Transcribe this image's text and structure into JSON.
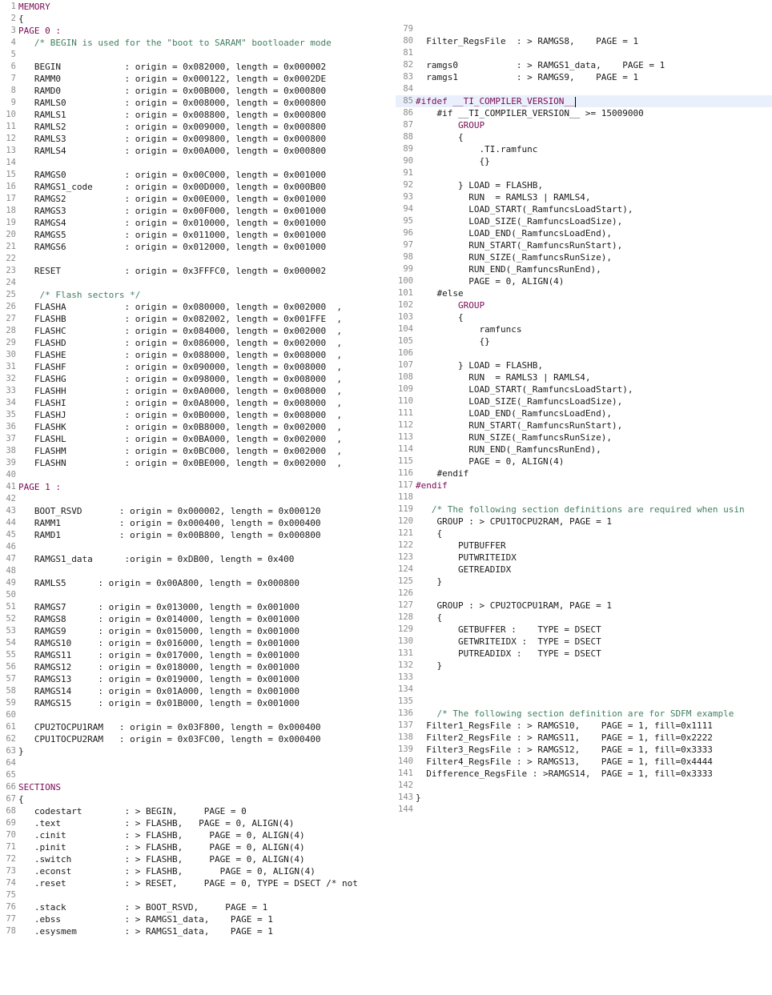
{
  "left_lines": [
    {
      "n": "1",
      "t": "MEMORY",
      "c": "kw"
    },
    {
      "n": "2",
      "t": "{"
    },
    {
      "n": "3",
      "t": "PAGE 0 :",
      "c": "kw"
    },
    {
      "n": "4",
      "t": "   /* BEGIN is used for the \"boot to SARAM\" bootloader mode",
      "c": "cm"
    },
    {
      "n": "5",
      "t": ""
    },
    {
      "n": "6",
      "t": "   BEGIN            : origin = 0x082000, length = 0x000002"
    },
    {
      "n": "7",
      "t": "   RAMM0            : origin = 0x000122, length = 0x0002DE"
    },
    {
      "n": "8",
      "t": "   RAMD0            : origin = 0x00B000, length = 0x000800"
    },
    {
      "n": "9",
      "t": "   RAMLS0           : origin = 0x008000, length = 0x000800"
    },
    {
      "n": "10",
      "t": "   RAMLS1           : origin = 0x008800, length = 0x000800"
    },
    {
      "n": "11",
      "t": "   RAMLS2           : origin = 0x009000, length = 0x000800"
    },
    {
      "n": "12",
      "t": "   RAMLS3           : origin = 0x009800, length = 0x000800"
    },
    {
      "n": "13",
      "t": "   RAMLS4           : origin = 0x00A000, length = 0x000800"
    },
    {
      "n": "14",
      "t": ""
    },
    {
      "n": "15",
      "t": "   RAMGS0           : origin = 0x00C000, length = 0x001000"
    },
    {
      "n": "16",
      "t": "   RAMGS1_code      : origin = 0x00D000, length = 0x000B00"
    },
    {
      "n": "17",
      "t": "   RAMGS2           : origin = 0x00E000, length = 0x001000"
    },
    {
      "n": "18",
      "t": "   RAMGS3           : origin = 0x00F000, length = 0x001000"
    },
    {
      "n": "19",
      "t": "   RAMGS4           : origin = 0x010000, length = 0x001000"
    },
    {
      "n": "20",
      "t": "   RAMGS5           : origin = 0x011000, length = 0x001000"
    },
    {
      "n": "21",
      "t": "   RAMGS6           : origin = 0x012000, length = 0x001000"
    },
    {
      "n": "22",
      "t": ""
    },
    {
      "n": "23",
      "t": "   RESET            : origin = 0x3FFFC0, length = 0x000002"
    },
    {
      "n": "24",
      "t": ""
    },
    {
      "n": "25",
      "t": "    /* Flash sectors */",
      "c": "cm"
    },
    {
      "n": "26",
      "t": "   FLASHA           : origin = 0x080000, length = 0x002000  ,"
    },
    {
      "n": "27",
      "t": "   FLASHB           : origin = 0x082002, length = 0x001FFE  ,"
    },
    {
      "n": "28",
      "t": "   FLASHC           : origin = 0x084000, length = 0x002000  ,"
    },
    {
      "n": "29",
      "t": "   FLASHD           : origin = 0x086000, length = 0x002000  ,"
    },
    {
      "n": "30",
      "t": "   FLASHE           : origin = 0x088000, length = 0x008000  ,"
    },
    {
      "n": "31",
      "t": "   FLASHF           : origin = 0x090000, length = 0x008000  ,"
    },
    {
      "n": "32",
      "t": "   FLASHG           : origin = 0x098000, length = 0x008000  ,"
    },
    {
      "n": "33",
      "t": "   FLASHH           : origin = 0x0A0000, length = 0x008000  ,"
    },
    {
      "n": "34",
      "t": "   FLASHI           : origin = 0x0A8000, length = 0x008000  ,"
    },
    {
      "n": "35",
      "t": "   FLASHJ           : origin = 0x0B0000, length = 0x008000  ,"
    },
    {
      "n": "36",
      "t": "   FLASHK           : origin = 0x0B8000, length = 0x002000  ,"
    },
    {
      "n": "37",
      "t": "   FLASHL           : origin = 0x0BA000, length = 0x002000  ,"
    },
    {
      "n": "38",
      "t": "   FLASHM           : origin = 0x0BC000, length = 0x002000  ,"
    },
    {
      "n": "39",
      "t": "   FLASHN           : origin = 0x0BE000, length = 0x002000  ,"
    },
    {
      "n": "40",
      "t": ""
    },
    {
      "n": "41",
      "t": "PAGE 1 :",
      "c": "kw"
    },
    {
      "n": "42",
      "t": ""
    },
    {
      "n": "43",
      "t": "   BOOT_RSVD       : origin = 0x000002, length = 0x000120"
    },
    {
      "n": "44",
      "t": "   RAMM1           : origin = 0x000400, length = 0x000400"
    },
    {
      "n": "45",
      "t": "   RAMD1           : origin = 0x00B800, length = 0x000800"
    },
    {
      "n": "46",
      "t": ""
    },
    {
      "n": "47",
      "t": "   RAMGS1_data      :origin = 0xDB00, length = 0x400"
    },
    {
      "n": "48",
      "t": ""
    },
    {
      "n": "49",
      "t": "   RAMLS5      : origin = 0x00A800, length = 0x000800"
    },
    {
      "n": "50",
      "t": ""
    },
    {
      "n": "51",
      "t": "   RAMGS7      : origin = 0x013000, length = 0x001000"
    },
    {
      "n": "52",
      "t": "   RAMGS8      : origin = 0x014000, length = 0x001000"
    },
    {
      "n": "53",
      "t": "   RAMGS9      : origin = 0x015000, length = 0x001000"
    },
    {
      "n": "54",
      "t": "   RAMGS10     : origin = 0x016000, length = 0x001000"
    },
    {
      "n": "55",
      "t": "   RAMGS11     : origin = 0x017000, length = 0x001000"
    },
    {
      "n": "56",
      "t": "   RAMGS12     : origin = 0x018000, length = 0x001000"
    },
    {
      "n": "57",
      "t": "   RAMGS13     : origin = 0x019000, length = 0x001000"
    },
    {
      "n": "58",
      "t": "   RAMGS14     : origin = 0x01A000, length = 0x001000"
    },
    {
      "n": "59",
      "t": "   RAMGS15     : origin = 0x01B000, length = 0x001000"
    },
    {
      "n": "60",
      "t": ""
    },
    {
      "n": "61",
      "t": "   CPU2TOCPU1RAM   : origin = 0x03F800, length = 0x000400"
    },
    {
      "n": "62",
      "t": "   CPU1TOCPU2RAM   : origin = 0x03FC00, length = 0x000400"
    },
    {
      "n": "63",
      "t": "}"
    },
    {
      "n": "64",
      "t": ""
    },
    {
      "n": "65",
      "t": ""
    },
    {
      "n": "66",
      "t": "SECTIONS",
      "c": "kw"
    },
    {
      "n": "67",
      "t": "{"
    },
    {
      "n": "68",
      "t": "   codestart        : > BEGIN,     PAGE = 0"
    },
    {
      "n": "69",
      "t": "   .text            : > FLASHB,   PAGE = 0, ALIGN(4)"
    },
    {
      "n": "70",
      "t": "   .cinit           : > FLASHB,     PAGE = 0, ALIGN(4)"
    },
    {
      "n": "71",
      "t": "   .pinit           : > FLASHB,     PAGE = 0, ALIGN(4)"
    },
    {
      "n": "72",
      "t": "   .switch          : > FLASHB,     PAGE = 0, ALIGN(4)"
    },
    {
      "n": "73",
      "t": "   .econst          : > FLASHB,       PAGE = 0, ALIGN(4)"
    },
    {
      "n": "74",
      "t": "   .reset           : > RESET,     PAGE = 0, TYPE = DSECT /* not us"
    },
    {
      "n": "75",
      "t": ""
    },
    {
      "n": "76",
      "t": "   .stack           : > BOOT_RSVD,     PAGE = 1"
    },
    {
      "n": "77",
      "t": "   .ebss            : > RAMGS1_data,    PAGE = 1"
    },
    {
      "n": "78",
      "t": "   .esysmem         : > RAMGS1_data,    PAGE = 1"
    }
  ],
  "right_lines": [
    {
      "n": "",
      "t": ""
    },
    {
      "n": "79",
      "t": ""
    },
    {
      "n": "80",
      "t": "  Filter_RegsFile  : > RAMGS8,    PAGE = 1"
    },
    {
      "n": "81",
      "t": ""
    },
    {
      "n": "82",
      "t": "  ramgs0           : > RAMGS1_data,    PAGE = 1"
    },
    {
      "n": "83",
      "t": "  ramgs1           : > RAMGS9,    PAGE = 1"
    },
    {
      "n": "84",
      "t": ""
    },
    {
      "n": "85",
      "t": "#ifdef __TI_COMPILER_VERSION__",
      "c": "pp",
      "hl": true,
      "caret": true
    },
    {
      "n": "86",
      "t": "    #if __TI_COMPILER_VERSION__ >= 15009000"
    },
    {
      "n": "87",
      "t": "        GROUP",
      "c": "kw"
    },
    {
      "n": "88",
      "t": "        {"
    },
    {
      "n": "89",
      "t": "            .TI.ramfunc"
    },
    {
      "n": "90",
      "t": "            {}"
    },
    {
      "n": "91",
      "t": ""
    },
    {
      "n": "92",
      "t": "        } LOAD = FLASHB,"
    },
    {
      "n": "93",
      "t": "          RUN  = RAMLS3 | RAMLS4,"
    },
    {
      "n": "94",
      "t": "          LOAD_START(_RamfuncsLoadStart),"
    },
    {
      "n": "95",
      "t": "          LOAD_SIZE(_RamfuncsLoadSize),"
    },
    {
      "n": "96",
      "t": "          LOAD_END(_RamfuncsLoadEnd),"
    },
    {
      "n": "97",
      "t": "          RUN_START(_RamfuncsRunStart),"
    },
    {
      "n": "98",
      "t": "          RUN_SIZE(_RamfuncsRunSize),"
    },
    {
      "n": "99",
      "t": "          RUN_END(_RamfuncsRunEnd),"
    },
    {
      "n": "100",
      "t": "          PAGE = 0, ALIGN(4)"
    },
    {
      "n": "101",
      "t": "    #else"
    },
    {
      "n": "102",
      "t": "        GROUP",
      "c": "kw"
    },
    {
      "n": "103",
      "t": "        {"
    },
    {
      "n": "104",
      "t": "            ramfuncs"
    },
    {
      "n": "105",
      "t": "            {}"
    },
    {
      "n": "106",
      "t": ""
    },
    {
      "n": "107",
      "t": "        } LOAD = FLASHB,"
    },
    {
      "n": "108",
      "t": "          RUN  = RAMLS3 | RAMLS4,"
    },
    {
      "n": "109",
      "t": "          LOAD_START(_RamfuncsLoadStart),"
    },
    {
      "n": "110",
      "t": "          LOAD_SIZE(_RamfuncsLoadSize),"
    },
    {
      "n": "111",
      "t": "          LOAD_END(_RamfuncsLoadEnd),"
    },
    {
      "n": "112",
      "t": "          RUN_START(_RamfuncsRunStart),"
    },
    {
      "n": "113",
      "t": "          RUN_SIZE(_RamfuncsRunSize),"
    },
    {
      "n": "114",
      "t": "          RUN_END(_RamfuncsRunEnd),"
    },
    {
      "n": "115",
      "t": "          PAGE = 0, ALIGN(4)"
    },
    {
      "n": "116",
      "t": "    #endif"
    },
    {
      "n": "117",
      "t": "#endif",
      "c": "pp"
    },
    {
      "n": "118",
      "t": ""
    },
    {
      "n": "119",
      "t": "   /* The following section definitions are required when usin",
      "c": "cm"
    },
    {
      "n": "120",
      "t": "    GROUP : > CPU1TOCPU2RAM, PAGE = 1"
    },
    {
      "n": "121",
      "t": "    {"
    },
    {
      "n": "122",
      "t": "        PUTBUFFER"
    },
    {
      "n": "123",
      "t": "        PUTWRITEIDX"
    },
    {
      "n": "124",
      "t": "        GETREADIDX"
    },
    {
      "n": "125",
      "t": "    }"
    },
    {
      "n": "126",
      "t": ""
    },
    {
      "n": "127",
      "t": "    GROUP : > CPU2TOCPU1RAM, PAGE = 1"
    },
    {
      "n": "128",
      "t": "    {"
    },
    {
      "n": "129",
      "t": "        GETBUFFER :    TYPE = DSECT"
    },
    {
      "n": "130",
      "t": "        GETWRITEIDX :  TYPE = DSECT"
    },
    {
      "n": "131",
      "t": "        PUTREADIDX :   TYPE = DSECT"
    },
    {
      "n": "132",
      "t": "    }"
    },
    {
      "n": "133",
      "t": ""
    },
    {
      "n": "134",
      "t": ""
    },
    {
      "n": "135",
      "t": ""
    },
    {
      "n": "136",
      "t": "    /* The following section definition are for SDFM example",
      "c": "cm"
    },
    {
      "n": "137",
      "t": "  Filter1_RegsFile : > RAMGS10,    PAGE = 1, fill=0x1111"
    },
    {
      "n": "138",
      "t": "  Filter2_RegsFile : > RAMGS11,    PAGE = 1, fill=0x2222"
    },
    {
      "n": "139",
      "t": "  Filter3_RegsFile : > RAMGS12,    PAGE = 1, fill=0x3333"
    },
    {
      "n": "140",
      "t": "  Filter4_RegsFile : > RAMGS13,    PAGE = 1, fill=0x4444"
    },
    {
      "n": "141",
      "t": "  Difference_RegsFile : >RAMGS14,  PAGE = 1, fill=0x3333"
    },
    {
      "n": "142",
      "t": ""
    },
    {
      "n": "143",
      "t": "}"
    },
    {
      "n": "144",
      "t": ""
    }
  ],
  "colors": {
    "keyword": "#7a0a55",
    "comment": "#3f7f5f",
    "line_number": "#8a8a8a",
    "highlight": "#eaf0fb"
  }
}
